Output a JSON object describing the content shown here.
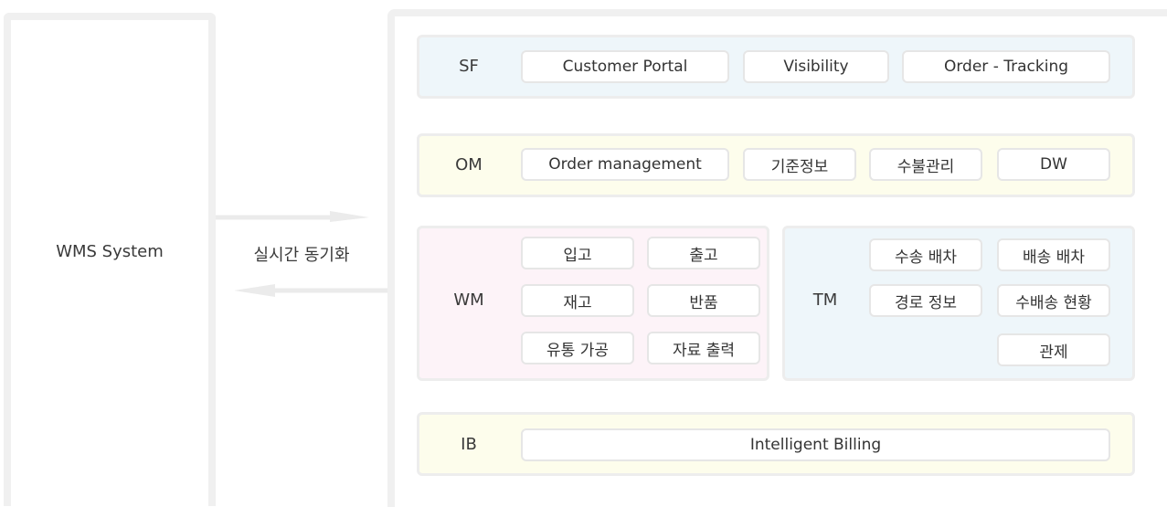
{
  "wms": {
    "label": "WMS System"
  },
  "sync": {
    "label": "실시간 동기화"
  },
  "colors": {
    "sf": "#eef6fa",
    "om": "#fdfdec",
    "wm": "#fdf3f8",
    "tm": "#eef6fa",
    "ib": "#fdfdec",
    "border": "#ededed",
    "arrow": "#ebebeb"
  },
  "sf": {
    "label": "SF",
    "chips": [
      "Customer Portal",
      "Visibility",
      "Order - Tracking"
    ]
  },
  "om": {
    "label": "OM",
    "chips": [
      "Order management",
      "기준정보",
      "수불관리",
      "DW"
    ]
  },
  "wm": {
    "label": "WM",
    "chips": [
      "입고",
      "출고",
      "재고",
      "반품",
      "유통 가공",
      "자료 출력"
    ]
  },
  "tm": {
    "label": "TM",
    "chips": [
      "수송 배차",
      "배송 배차",
      "경로 정보",
      "수배송 현황",
      "관제"
    ]
  },
  "ib": {
    "label": "IB",
    "chips": [
      "Intelligent Billing"
    ]
  }
}
